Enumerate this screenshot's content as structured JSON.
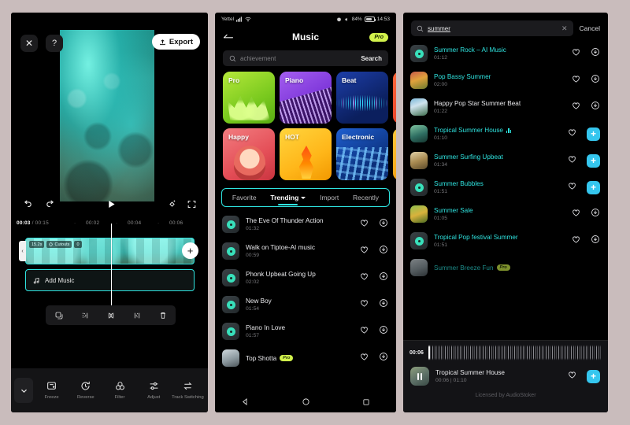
{
  "editor": {
    "close_label": "✕",
    "help_label": "?",
    "export_label": "Export",
    "time_current": "00:03",
    "time_total": "/ 00:15",
    "ruler_ticks": [
      "00:02",
      "00:04",
      "00:06"
    ],
    "clip_badge_duration": "15.2s",
    "clip_badge_feature": "Cutouts",
    "clip_badge_count": "0",
    "add_clip_label": "+",
    "add_music_label": "Add Music",
    "context_actions": [
      "copy",
      "split-left",
      "split",
      "split-right",
      "delete"
    ],
    "tools": [
      {
        "label": "Freeze",
        "icon": "freeze-icon"
      },
      {
        "label": "Reverse",
        "icon": "reverse-icon"
      },
      {
        "label": "Filter",
        "icon": "filter-icon"
      },
      {
        "label": "Adjust",
        "icon": "adjust-icon"
      },
      {
        "label": "Track Switching",
        "icon": "track-switch-icon"
      }
    ],
    "accent": "#2fe4e0"
  },
  "music": {
    "status": {
      "carrier": "Yettel",
      "battery": "84%",
      "clock": "14:53"
    },
    "title": "Music",
    "pro_badge": "Pro",
    "search_placeholder": "achievement",
    "search_button": "Search",
    "tiles": [
      {
        "label": "Pro",
        "class": "t-pro"
      },
      {
        "label": "Piano",
        "class": "t-piano"
      },
      {
        "label": "Beat",
        "class": "t-beat"
      },
      {
        "label": "",
        "class": "t-edge1"
      },
      {
        "label": "Happy",
        "class": "t-happy"
      },
      {
        "label": "HOT",
        "class": "t-hot"
      },
      {
        "label": "Electronic",
        "class": "t-elec"
      },
      {
        "label": "",
        "class": "t-edge2"
      }
    ],
    "tabs": [
      {
        "label": "Favorite",
        "active": false,
        "caret": false
      },
      {
        "label": "Trending",
        "active": true,
        "caret": true
      },
      {
        "label": "Import",
        "active": false,
        "caret": false
      },
      {
        "label": "Recently",
        "active": false,
        "caret": false
      }
    ],
    "songs": [
      {
        "name": "The Eve Of Thunder Action",
        "duration": "01:32",
        "thumb": "disc",
        "action": "download",
        "pro": false
      },
      {
        "name": "Walk on Tiptoe-AI music",
        "duration": "00:59",
        "thumb": "disc",
        "action": "download",
        "pro": false
      },
      {
        "name": "Phonk Upbeat Going Up",
        "duration": "02:02",
        "thumb": "disc",
        "action": "download",
        "pro": false
      },
      {
        "name": "New Boy",
        "duration": "01:54",
        "thumb": "disc",
        "action": "download",
        "pro": false
      },
      {
        "name": "Piano In Love",
        "duration": "01:57",
        "thumb": "disc",
        "action": "download",
        "pro": false
      },
      {
        "name": "Top Shotta",
        "duration": "",
        "thumb": "photo6",
        "action": "download",
        "pro": true
      }
    ]
  },
  "search": {
    "query": "summer",
    "clear_label": "✕",
    "cancel_label": "Cancel",
    "results": [
      {
        "name": "Summer Rock – AI Music",
        "duration": "01:12",
        "thumb": "disc",
        "action": "download",
        "playing": false
      },
      {
        "name": "Pop Bassy Summer",
        "duration": "02:00",
        "thumb": "photo1",
        "action": "download",
        "playing": false
      },
      {
        "name": "Happy Pop Star Summer Beat",
        "duration": "01:22",
        "thumb": "photo2",
        "action": "download",
        "playing": false
      },
      {
        "name": "Tropical Summer House",
        "duration": "01:10",
        "thumb": "photo3",
        "action": "add",
        "playing": true
      },
      {
        "name": "Summer Surfing Upbeat",
        "duration": "01:34",
        "thumb": "photo4",
        "action": "add",
        "playing": false
      },
      {
        "name": "Summer Bubbles",
        "duration": "01:51",
        "thumb": "disc",
        "action": "add",
        "playing": false
      },
      {
        "name": "Summer Sale",
        "duration": "01:05",
        "thumb": "photo5",
        "action": "download",
        "playing": false
      },
      {
        "name": "Tropical Pop festival Summer",
        "duration": "01:51",
        "thumb": "disc",
        "action": "download",
        "playing": false
      },
      {
        "name": "Summer Breeze Fun",
        "duration": "",
        "thumb": "photo6",
        "action": "download",
        "playing": false
      }
    ],
    "player": {
      "position": "00:06",
      "track_name": "Tropical Summer House",
      "progress_label": "00:06 | 01:10",
      "add_label": "+",
      "license": "Licensed by AudioStoker"
    },
    "highlight_color": "#2fe4e0",
    "add_color": "#35c6ee"
  }
}
